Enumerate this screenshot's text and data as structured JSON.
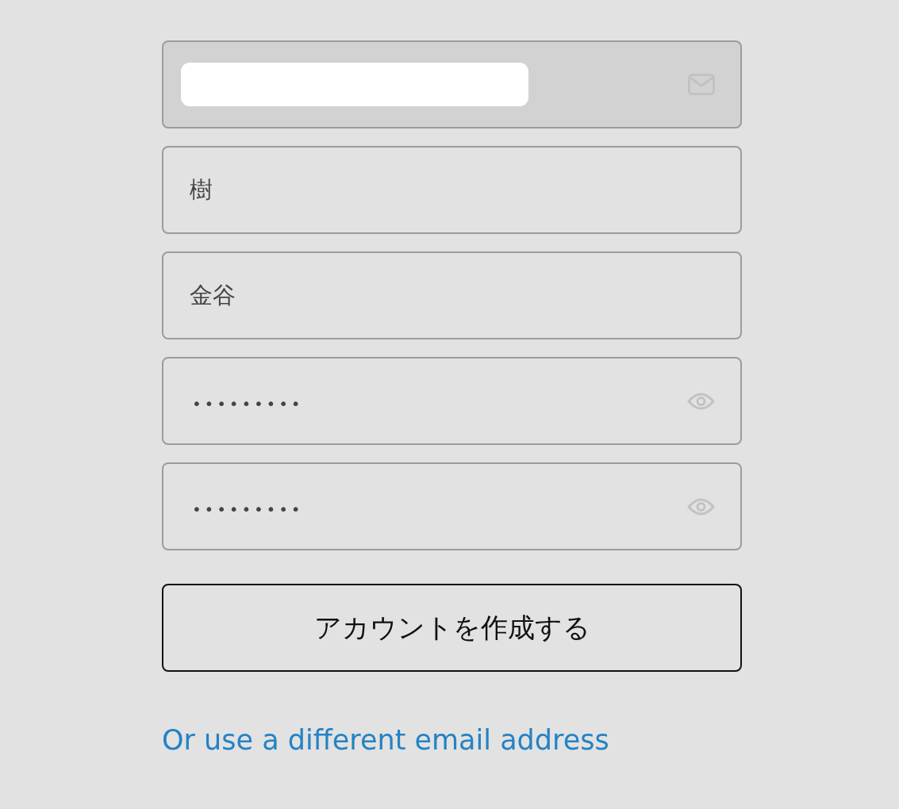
{
  "fields": [
    {
      "kind": "email",
      "disabled": true,
      "redacted": true
    },
    {
      "kind": "text",
      "disabled": false,
      "redacted": false,
      "value": "樹"
    },
    {
      "kind": "text",
      "disabled": false,
      "redacted": false,
      "value": "金谷"
    },
    {
      "kind": "password",
      "disabled": false,
      "redacted": false,
      "value": "•••••••••"
    },
    {
      "kind": "password",
      "disabled": false,
      "redacted": false,
      "value": "•••••••••"
    }
  ],
  "submit_button": {
    "label": "アカウントを作成する"
  },
  "alternate_link": {
    "label": "Or use a different email address"
  }
}
